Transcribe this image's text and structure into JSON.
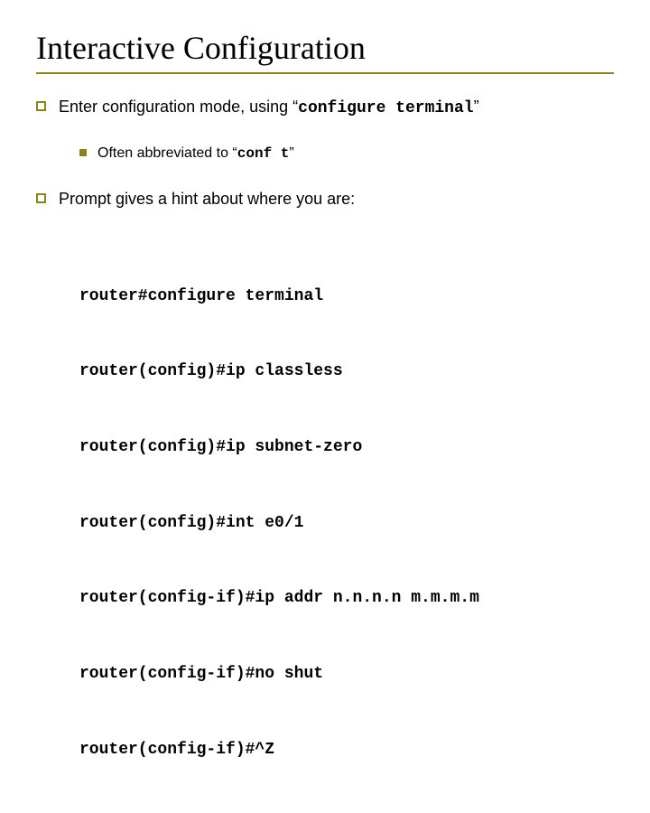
{
  "title": "Interactive Configuration",
  "bullets": {
    "b1_prefix": "Enter configuration mode, using “",
    "b1_code": "configure terminal",
    "b1_suffix": "”",
    "b1a_prefix": "Often abbreviated to “",
    "b1a_code": "conf t",
    "b1a_suffix": "”",
    "b2": "Prompt gives a hint about where you are:"
  },
  "code_lines": {
    "l1": "router#configure terminal",
    "l2": "router(config)#ip classless",
    "l3": "router(config)#ip subnet-zero",
    "l4": "router(config)#int e0/1",
    "l5": "router(config-if)#ip addr n.n.n.n m.m.m.m",
    "l6": "router(config-if)#no shut",
    "l7": "router(config-if)#^Z"
  }
}
